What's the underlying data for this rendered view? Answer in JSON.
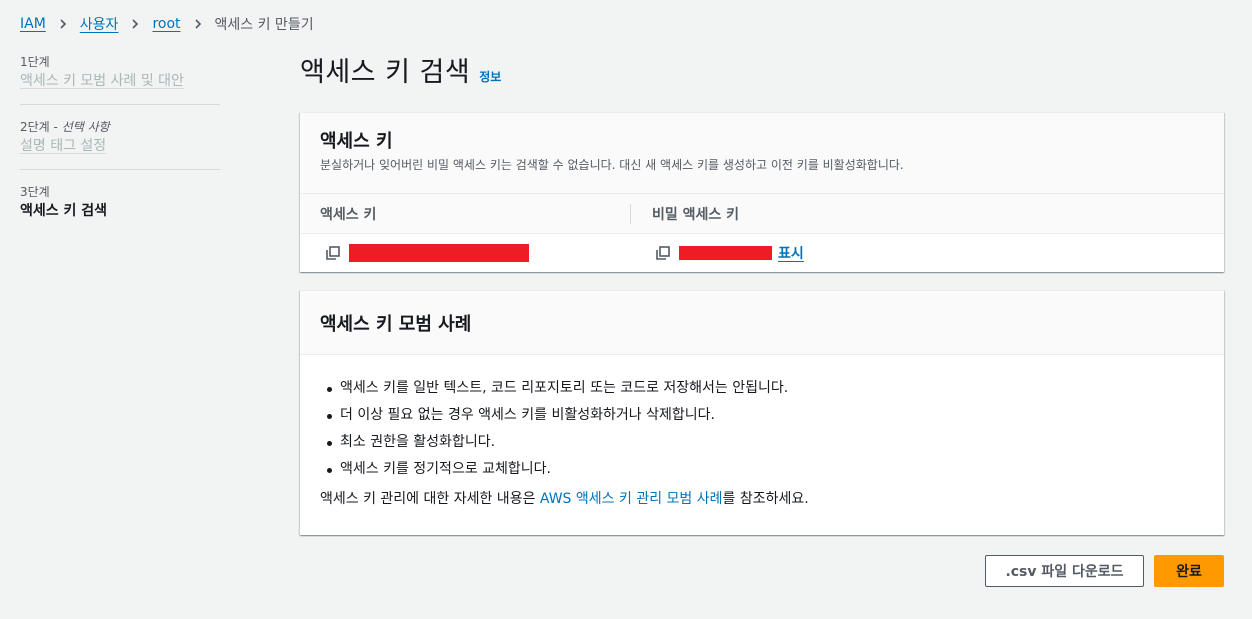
{
  "breadcrumb": {
    "items": [
      "IAM",
      "사용자",
      "root"
    ],
    "current": "액세스 키 만들기"
  },
  "steps": [
    {
      "num": "1단계",
      "optional": "",
      "title": "액세스 키 모범 사례 및 대안"
    },
    {
      "num": "2단계 - ",
      "optional": "선택 사항",
      "title": "설명 태그 설정"
    },
    {
      "num": "3단계",
      "optional": "",
      "title": "액세스 키 검색"
    }
  ],
  "page": {
    "title": "액세스 키 검색",
    "info": "정보"
  },
  "keys_panel": {
    "title": "액세스 키",
    "description": "분실하거나 잊어버린 비밀 액세스 키는 검색할 수 없습니다. 대신 새 액세스 키를 생성하고 이전 키를 비활성화합니다.",
    "columns": [
      "액세스 키",
      "비밀 액세스 키"
    ],
    "show_label": "표시",
    "redaction_color": "#ee1c25"
  },
  "best_panel": {
    "title": "액세스 키 모범 사례",
    "bullets": [
      "액세스 키를 일반 텍스트, 코드 리포지토리 또는 코드로 저장해서는 안됩니다.",
      "더 이상 필요 없는 경우 액세스 키를 비활성화하거나 삭제합니다.",
      "최소 권한을 활성화합니다.",
      "액세스 키를 정기적으로 교체합니다."
    ],
    "ref_prefix": "액세스 키 관리에 대한 자세한 내용은 ",
    "ref_link": "AWS 액세스 키 관리 모범 사례",
    "ref_suffix": "를 참조하세요."
  },
  "buttons": {
    "csv": ".csv 파일 다운로드",
    "done": "완료"
  },
  "colors": {
    "link": "#0073bb",
    "primary_button": "#ff9900",
    "background": "#f2f3f3"
  }
}
